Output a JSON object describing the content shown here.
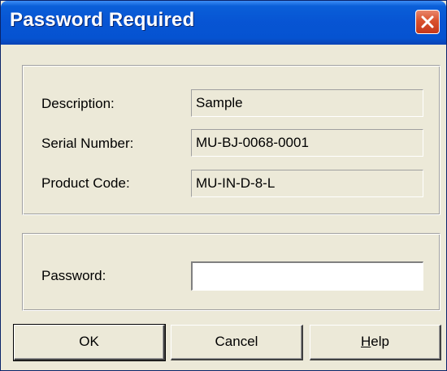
{
  "window": {
    "title": "Password Required"
  },
  "titlebar_icons": {
    "close": "close-icon"
  },
  "info": {
    "fields": [
      {
        "label": "Description:",
        "value": "Sample"
      },
      {
        "label": "Serial Number:",
        "value": "MU-BJ-0068-0001"
      },
      {
        "label": "Product Code:",
        "value": "MU-IN-D-8-L"
      }
    ]
  },
  "password": {
    "label": "Password:",
    "value": ""
  },
  "buttons": {
    "ok": "OK",
    "cancel": "Cancel",
    "help_accel": "H",
    "help_rest": "elp"
  },
  "colors": {
    "titlebar": "#0754d3",
    "dialog_bg": "#ece9d8",
    "close_button": "#d9512d"
  }
}
